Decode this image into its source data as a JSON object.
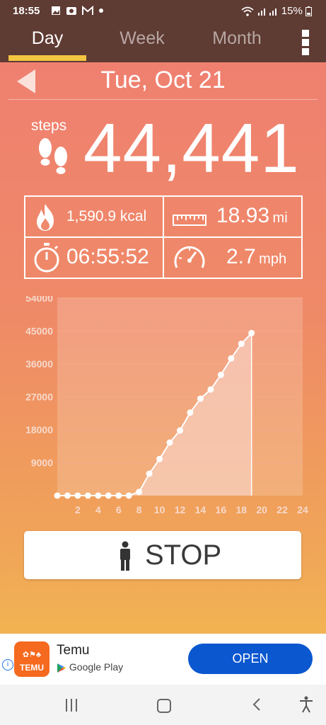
{
  "status_bar": {
    "time": "18:55",
    "notification_icons": [
      "image-icon",
      "photo-icon",
      "gmail-icon",
      "dot"
    ],
    "battery": "15%"
  },
  "tabs": [
    {
      "label": "Day",
      "active": true
    },
    {
      "label": "Week",
      "active": false
    },
    {
      "label": "Month",
      "active": false
    }
  ],
  "date": "Tue, Oct 21",
  "steps": {
    "label": "steps",
    "value": "44,441"
  },
  "stats": {
    "calories": {
      "value": "1,590.9",
      "unit": "kcal"
    },
    "distance": {
      "value": "18.93",
      "unit": "mi"
    },
    "time": {
      "value": "06:55:52"
    },
    "speed": {
      "value": "2.7",
      "unit": "mph"
    }
  },
  "chart_data": {
    "type": "area",
    "x": [
      0,
      1,
      2,
      3,
      4,
      5,
      6,
      7,
      8,
      9,
      10,
      11,
      12,
      13,
      14,
      15,
      16,
      17,
      18,
      19
    ],
    "y": [
      0,
      0,
      0,
      0,
      0,
      0,
      0,
      0,
      1000,
      6000,
      10000,
      14500,
      17800,
      22700,
      26500,
      29000,
      33000,
      37500,
      41500,
      44441
    ],
    "x_ticks": [
      "2",
      "4",
      "6",
      "8",
      "10",
      "12",
      "14",
      "16",
      "18",
      "20",
      "22",
      "24"
    ],
    "y_ticks": [
      "54000",
      "45000",
      "36000",
      "27000",
      "18000",
      "9000"
    ],
    "xlim": [
      0,
      24
    ],
    "ylim": [
      0,
      54000
    ],
    "grid": true,
    "colors": {
      "line": "#ffffff",
      "fill": "#f8d3c4",
      "grid": "#f6a784",
      "tick_label": "#f7d9cb"
    }
  },
  "stop_button": {
    "label": "STOP"
  },
  "ad": {
    "app_name": "Temu",
    "logo_text": "TEMU",
    "store": "Google Play",
    "button": "OPEN"
  },
  "nav_bar": {
    "icons": [
      "recent-apps-icon",
      "home-icon",
      "back-icon",
      "accessibility-icon"
    ]
  }
}
